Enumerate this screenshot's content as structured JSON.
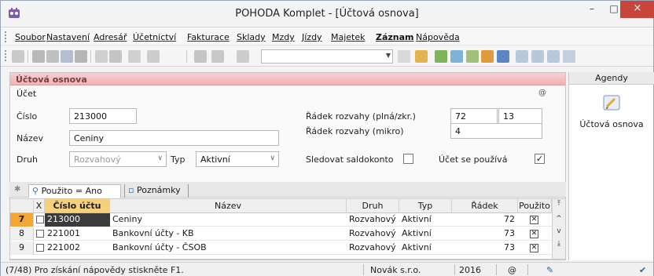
{
  "window": {
    "title": "POHODA Komplet - [Účtová osnova]",
    "controls": [
      "–",
      "□",
      "×"
    ]
  },
  "menu": [
    "Soubor",
    "Nastavení",
    "Adresář",
    "Účetnictví",
    "Fakturace",
    "Sklady",
    "Mzdy",
    "Jízdy",
    "Majetek",
    "Záznam",
    "Nápověda"
  ],
  "toolbar": {
    "combo_value": ""
  },
  "form": {
    "panel_title": "Účtová osnova",
    "group_label": "Účet",
    "at_symbol": "@",
    "cislo_label": "Číslo",
    "cislo_value": "213000",
    "nazev_label": "Název",
    "nazev_value": "Ceniny",
    "druh_label": "Druh",
    "druh_value": "Rozvahový",
    "typ_label": "Typ",
    "typ_value": "Aktivní",
    "radek_plna_label": "Řádek rozvahy (plná/zkr.)",
    "radek_plna_value": "72",
    "radek_zkr_value": "13",
    "radek_mikro_label": "Řádek rozvahy (mikro)",
    "radek_mikro_value": "4",
    "saldokonto_label": "Sledovat saldokonto",
    "saldokonto_checked": false,
    "pouziva_label": "Účet se používá",
    "pouziva_checked": true
  },
  "tabs": [
    {
      "label": "Použito = Ano"
    },
    {
      "label": "Poznámky"
    }
  ],
  "table": {
    "columns": [
      "X",
      "Číslo účtu",
      "Název",
      "Druh",
      "Typ",
      "Řádek",
      "Použito"
    ],
    "rows": [
      {
        "num": "7",
        "cislo": "213000",
        "nazev": "Ceniny",
        "druh": "Rozvahový",
        "typ": "Aktivní",
        "radek": "72",
        "pouzito": true,
        "current": true
      },
      {
        "num": "8",
        "cislo": "221001",
        "nazev": "Bankovní účty - KB",
        "druh": "Rozvahový",
        "typ": "Aktivní",
        "radek": "73",
        "pouzito": true,
        "current": false
      },
      {
        "num": "9",
        "cislo": "221002",
        "nazev": "Bankovní účty - ČSOB",
        "druh": "Rozvahový",
        "typ": "Aktivní",
        "radek": "73",
        "pouzito": true,
        "current": false
      }
    ]
  },
  "agenda": {
    "header": "Agendy",
    "item_label": "Účtová osnova"
  },
  "status": {
    "hint": "(7/48) Pro získání nápovědy stiskněte F1.",
    "company": "Novák s.r.o.",
    "year": "2016",
    "at": "@"
  }
}
